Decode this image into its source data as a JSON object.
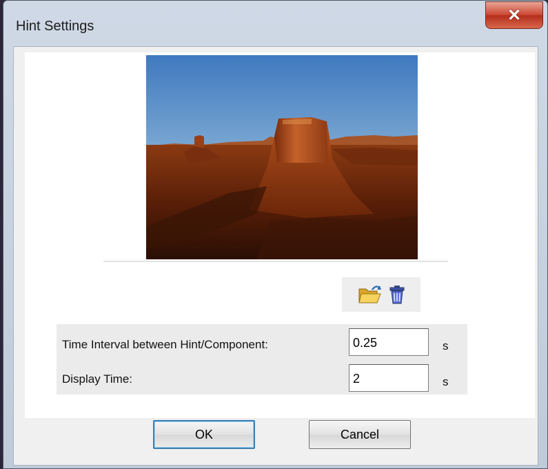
{
  "window": {
    "title": "Hint Settings",
    "close_glyph": "✕"
  },
  "preview": {
    "image_icon": "desert-landscape-image"
  },
  "toolbar": {
    "open_icon": "open-folder-icon",
    "delete_icon": "trash-icon"
  },
  "settings": {
    "interval_label": "Time Interval between Hint/Component:",
    "interval_value": "0.25",
    "interval_unit": "s",
    "display_label": "Display Time:",
    "display_value": "2",
    "display_unit": "s"
  },
  "buttons": {
    "ok_label": "OK",
    "cancel_label": "Cancel"
  },
  "colors": {
    "close_button": "#cc4a35",
    "default_button_border": "#3c7fb1"
  }
}
